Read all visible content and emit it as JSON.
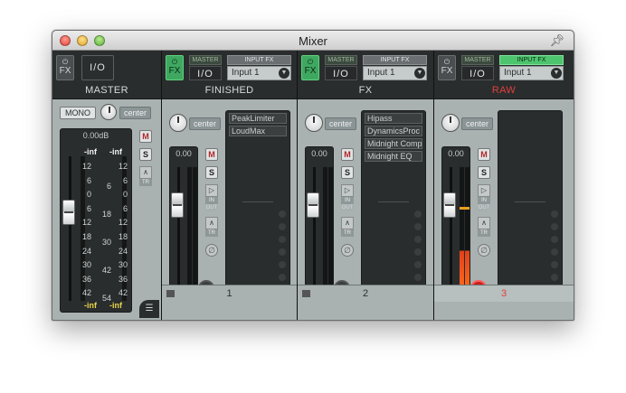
{
  "window": {
    "title": "Mixer"
  },
  "master": {
    "name": "MASTER",
    "fx_label": "FX",
    "io_label": "I/O",
    "mono_label": "MONO",
    "pan_label": "center",
    "db_readout": "0.00dB",
    "peak_left": "-inf",
    "peak_right": "-inf",
    "bottom_left": "-inf",
    "bottom_right": "-inf",
    "scale_left": [
      "12",
      "6",
      "0",
      "6",
      "12",
      "18",
      "24",
      "30",
      "36",
      "42"
    ],
    "scale_mid": [
      "6",
      "18",
      "30",
      "42",
      "54"
    ],
    "scale_right": [
      "12",
      "6",
      "0",
      "6",
      "12",
      "18",
      "24",
      "30",
      "36",
      "42"
    ],
    "m_label": "M",
    "s_label": "S",
    "tr_label": "TR"
  },
  "tracks": [
    {
      "name": "FINISHED",
      "number": "1",
      "fx_label": "FX",
      "fx_active": true,
      "master_label": "MASTER",
      "io_label": "I/O",
      "input_fx_label": "INPUT FX",
      "input_fx_active": false,
      "input": "Input 1",
      "pan_label": "center",
      "volume_readout": "0.00",
      "m_label": "M",
      "s_label": "S",
      "in_label": "IN",
      "out_label": "OUT",
      "tr_label": "TR",
      "fx_chain": [
        "PeakLimiter",
        "LoudMax"
      ],
      "rec_armed": false,
      "selected": false
    },
    {
      "name": "FX",
      "number": "2",
      "fx_label": "FX",
      "fx_active": true,
      "master_label": "MASTER",
      "io_label": "I/O",
      "input_fx_label": "INPUT FX",
      "input_fx_active": false,
      "input": "Input 1",
      "pan_label": "center",
      "volume_readout": "0.00",
      "m_label": "M",
      "s_label": "S",
      "in_label": "IN",
      "out_label": "OUT",
      "tr_label": "TR",
      "fx_chain": [
        "Hipass",
        "DynamicsProc",
        "Midnight Comp",
        "Midnight EQ"
      ],
      "rec_armed": false,
      "selected": false
    },
    {
      "name": "RAW",
      "number": "3",
      "fx_label": "FX",
      "fx_active": false,
      "master_label": "MASTER",
      "io_label": "I/O",
      "input_fx_label": "INPUT FX",
      "input_fx_active": true,
      "input": "Input 1",
      "pan_label": "center",
      "volume_readout": "0.00",
      "m_label": "M",
      "s_label": "S",
      "in_label": "IN",
      "out_label": "OUT",
      "tr_label": "TR",
      "fx_chain": [],
      "rec_armed": true,
      "selected": true
    }
  ],
  "colors": {
    "fx_active": "#3fa860",
    "input_fx_active": "#4ec46e",
    "selected_track_name": "#e0403a",
    "rec_armed": "#c81e1e",
    "meter_signal": "#e0401a"
  }
}
